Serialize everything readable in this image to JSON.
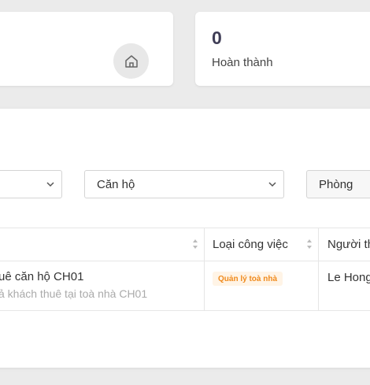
{
  "stats": {
    "left_card": {
      "icon": "home-icon"
    },
    "right_card": {
      "value": "0",
      "label": "Hoàn thành"
    }
  },
  "filters": {
    "select1": {
      "value": ""
    },
    "select2": {
      "value": "Căn hộ"
    },
    "select3": {
      "value": "Phòng"
    }
  },
  "table": {
    "headers": [
      "Loại công việc",
      "Người th"
    ],
    "rows": [
      {
        "title": "uê căn hộ CH01",
        "subtitle": "ả khách thuê tại toà nhà CH01",
        "type_tag": "Quản lý toà nhà",
        "person": "Le Hong"
      }
    ]
  },
  "colors": {
    "tag_text": "#f08a1c",
    "tag_bg": "#fff4e6",
    "stat_value": "#3f3d56"
  }
}
